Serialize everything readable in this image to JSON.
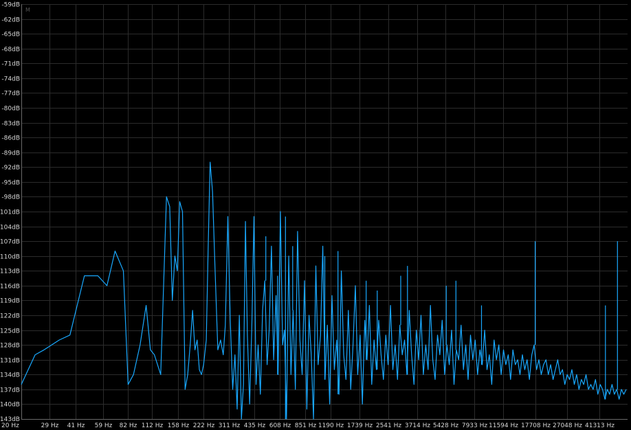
{
  "marker_label": "M",
  "chart_data": {
    "type": "line",
    "title": "",
    "xlabel": "",
    "ylabel": "",
    "xscale": "log",
    "xlim": [
      20,
      60000
    ],
    "ylim": [
      -143,
      -59
    ],
    "grid": true,
    "y_ticks": [
      "-59dB",
      "-62dB",
      "-65dB",
      "-68dB",
      "-71dB",
      "-74dB",
      "-77dB",
      "-80dB",
      "-83dB",
      "-86dB",
      "-89dB",
      "-92dB",
      "-95dB",
      "-98dB",
      "-101dB",
      "-104dB",
      "-107dB",
      "-110dB",
      "-113dB",
      "-116dB",
      "-119dB",
      "-122dB",
      "-125dB",
      "-128dB",
      "-131dB",
      "-134dB",
      "-137dB",
      "-140dB",
      "-143dB"
    ],
    "x_ticks": [
      {
        "label": "20 Hz",
        "hz": 20
      },
      {
        "label": "29 Hz",
        "hz": 29
      },
      {
        "label": "41 Hz",
        "hz": 41
      },
      {
        "label": "59 Hz",
        "hz": 59
      },
      {
        "label": "82 Hz",
        "hz": 82
      },
      {
        "label": "112 Hz",
        "hz": 112
      },
      {
        "label": "158 Hz",
        "hz": 158
      },
      {
        "label": "222 Hz",
        "hz": 222
      },
      {
        "label": "311 Hz",
        "hz": 311
      },
      {
        "label": "435 Hz",
        "hz": 435
      },
      {
        "label": "608 Hz",
        "hz": 608
      },
      {
        "label": "851 Hz",
        "hz": 851
      },
      {
        "label": "1190 Hz",
        "hz": 1190
      },
      {
        "label": "1739 Hz",
        "hz": 1739
      },
      {
        "label": "2541 Hz",
        "hz": 2541
      },
      {
        "label": "3714 Hz",
        "hz": 3714
      },
      {
        "label": "5428 Hz",
        "hz": 5428
      },
      {
        "label": "7933 Hz",
        "hz": 7933
      },
      {
        "label": "11594 Hz",
        "hz": 11594
      },
      {
        "label": "17708 Hz",
        "hz": 17708
      },
      {
        "label": "27048 Hz",
        "hz": 27048
      },
      {
        "label": "41313 Hz",
        "hz": 41313
      }
    ],
    "series": [
      {
        "values": [
          [
            20,
            -136
          ],
          [
            24,
            -130
          ],
          [
            27,
            -129
          ],
          [
            33,
            -127
          ],
          [
            38,
            -126
          ],
          [
            46,
            -114
          ],
          [
            55,
            -114
          ],
          [
            62,
            -116
          ],
          [
            69,
            -109
          ],
          [
            77,
            -113
          ],
          [
            82,
            -136
          ],
          [
            88,
            -134
          ],
          [
            96,
            -128
          ],
          [
            104,
            -120
          ],
          [
            110,
            -129
          ],
          [
            116,
            -130
          ],
          [
            126,
            -134
          ],
          [
            136,
            -98
          ],
          [
            142,
            -100
          ],
          [
            147,
            -119
          ],
          [
            152,
            -110
          ],
          [
            157,
            -113
          ],
          [
            162,
            -99
          ],
          [
            168,
            -101
          ],
          [
            174,
            -137
          ],
          [
            180,
            -134
          ],
          [
            186,
            -128
          ],
          [
            192,
            -121
          ],
          [
            198,
            -129
          ],
          [
            204,
            -127
          ],
          [
            210,
            -133
          ],
          [
            216,
            -134
          ],
          [
            222,
            -132
          ],
          [
            230,
            -127
          ],
          [
            236,
            -108
          ],
          [
            242,
            -91
          ],
          [
            250,
            -97
          ],
          [
            258,
            -112
          ],
          [
            268,
            -129
          ],
          [
            278,
            -127
          ],
          [
            288,
            -130
          ],
          [
            296,
            -124
          ],
          [
            306,
            -102
          ],
          [
            316,
            -123
          ],
          [
            326,
            -137
          ],
          [
            336,
            -130
          ],
          [
            346,
            -141
          ],
          [
            356,
            -122
          ],
          [
            366,
            -143
          ],
          [
            376,
            -136
          ],
          [
            386,
            -103
          ],
          [
            396,
            -126
          ],
          [
            408,
            -140
          ],
          [
            420,
            -124
          ],
          [
            432,
            -102
          ],
          [
            444,
            -136
          ],
          [
            456,
            -128
          ],
          [
            470,
            -138
          ],
          [
            484,
            -121
          ],
          [
            498,
            -115
          ],
          [
            514,
            -132
          ],
          [
            528,
            -125
          ],
          [
            544,
            -108
          ],
          [
            560,
            -131
          ],
          [
            578,
            -118
          ],
          [
            594,
            -134
          ],
          [
            612,
            -101
          ],
          [
            630,
            -128
          ],
          [
            646,
            -125
          ],
          [
            664,
            -143
          ],
          [
            684,
            -110
          ],
          [
            704,
            -134
          ],
          [
            724,
            -121
          ],
          [
            746,
            -137
          ],
          [
            768,
            -105
          ],
          [
            792,
            -127
          ],
          [
            816,
            -134
          ],
          [
            842,
            -115
          ],
          [
            868,
            -141
          ],
          [
            894,
            -122
          ],
          [
            920,
            -130
          ],
          [
            948,
            -143
          ],
          [
            978,
            -112
          ],
          [
            1008,
            -132
          ],
          [
            1040,
            -126
          ],
          [
            1072,
            -108
          ],
          [
            1104,
            -135
          ],
          [
            1138,
            -124
          ],
          [
            1174,
            -140
          ],
          [
            1210,
            -118
          ],
          [
            1248,
            -133
          ],
          [
            1288,
            -127
          ],
          [
            1328,
            -138
          ],
          [
            1370,
            -113
          ],
          [
            1412,
            -130
          ],
          [
            1456,
            -135
          ],
          [
            1502,
            -121
          ],
          [
            1550,
            -137
          ],
          [
            1598,
            -128
          ],
          [
            1648,
            -116
          ],
          [
            1700,
            -134
          ],
          [
            1754,
            -126
          ],
          [
            1808,
            -140
          ],
          [
            1866,
            -123
          ],
          [
            1924,
            -131
          ],
          [
            1984,
            -120
          ],
          [
            2046,
            -136
          ],
          [
            2110,
            -127
          ],
          [
            2176,
            -133
          ],
          [
            2244,
            -123
          ],
          [
            2314,
            -130
          ],
          [
            2388,
            -135
          ],
          [
            2464,
            -126
          ],
          [
            2540,
            -132
          ],
          [
            2620,
            -120
          ],
          [
            2702,
            -133
          ],
          [
            2788,
            -128
          ],
          [
            2876,
            -135
          ],
          [
            2966,
            -124
          ],
          [
            3060,
            -130
          ],
          [
            3156,
            -127
          ],
          [
            3256,
            -134
          ],
          [
            3358,
            -121
          ],
          [
            3464,
            -130
          ],
          [
            3574,
            -136
          ],
          [
            3686,
            -125
          ],
          [
            3802,
            -131
          ],
          [
            3922,
            -122
          ],
          [
            4046,
            -134
          ],
          [
            4174,
            -128
          ],
          [
            4306,
            -133
          ],
          [
            4442,
            -120
          ],
          [
            4582,
            -131
          ],
          [
            4726,
            -135
          ],
          [
            4876,
            -126
          ],
          [
            5030,
            -130
          ],
          [
            5188,
            -123
          ],
          [
            5352,
            -134
          ],
          [
            5522,
            -128
          ],
          [
            5696,
            -132
          ],
          [
            5876,
            -125
          ],
          [
            6062,
            -136
          ],
          [
            6254,
            -129
          ],
          [
            6452,
            -131
          ],
          [
            6656,
            -124
          ],
          [
            6866,
            -133
          ],
          [
            7082,
            -128
          ],
          [
            7306,
            -135
          ],
          [
            7538,
            -126
          ],
          [
            7776,
            -131
          ],
          [
            8022,
            -127
          ],
          [
            8276,
            -134
          ],
          [
            8538,
            -129
          ],
          [
            8808,
            -132
          ],
          [
            9086,
            -125
          ],
          [
            9374,
            -133
          ],
          [
            9670,
            -130
          ],
          [
            9976,
            -136
          ],
          [
            10292,
            -127
          ],
          [
            10618,
            -131
          ],
          [
            10954,
            -128
          ],
          [
            11300,
            -134
          ],
          [
            11658,
            -129
          ],
          [
            12026,
            -132
          ],
          [
            12406,
            -130
          ],
          [
            12800,
            -135
          ],
          [
            13204,
            -129
          ],
          [
            13622,
            -132
          ],
          [
            14052,
            -131
          ],
          [
            14496,
            -134
          ],
          [
            14956,
            -130
          ],
          [
            15428,
            -133
          ],
          [
            15916,
            -131
          ],
          [
            16420,
            -135
          ],
          [
            16940,
            -130
          ],
          [
            17476,
            -128
          ],
          [
            18030,
            -133
          ],
          [
            18600,
            -131
          ],
          [
            19188,
            -134
          ],
          [
            19796,
            -132
          ],
          [
            20420,
            -131
          ],
          [
            21068,
            -134
          ],
          [
            21734,
            -132
          ],
          [
            22422,
            -135
          ],
          [
            23132,
            -133
          ],
          [
            23864,
            -131
          ],
          [
            24618,
            -134
          ],
          [
            25398,
            -133
          ],
          [
            26202,
            -136
          ],
          [
            27030,
            -134
          ],
          [
            27886,
            -135
          ],
          [
            28768,
            -133
          ],
          [
            29680,
            -136
          ],
          [
            30618,
            -134
          ],
          [
            31588,
            -137
          ],
          [
            32588,
            -135
          ],
          [
            33618,
            -136
          ],
          [
            34682,
            -134
          ],
          [
            35780,
            -137
          ],
          [
            36912,
            -136
          ],
          [
            38080,
            -137
          ],
          [
            39286,
            -135
          ],
          [
            40528,
            -138
          ],
          [
            41812,
            -136
          ],
          [
            43134,
            -137
          ],
          [
            44500,
            -139
          ],
          [
            45908,
            -137
          ],
          [
            47362,
            -138
          ],
          [
            48860,
            -136
          ],
          [
            50406,
            -138
          ],
          [
            52002,
            -137
          ],
          [
            53648,
            -139
          ],
          [
            55346,
            -137
          ],
          [
            57098,
            -138
          ],
          [
            58906,
            -137
          ]
        ],
        "spikes": [
          [
            17708,
            -107
          ],
          [
            52500,
            -107
          ],
          [
            44800,
            -120
          ],
          [
            6220,
            -115
          ],
          [
            8720,
            -120
          ],
          [
            5470,
            -116
          ],
          [
            3000,
            -114
          ],
          [
            3280,
            -112
          ],
          [
            1900,
            -115
          ],
          [
            2200,
            -117
          ],
          [
            1100,
            -110
          ],
          [
            1310,
            -109
          ],
          [
            720,
            -108
          ],
          [
            655,
            -102
          ],
          [
            590,
            -114
          ],
          [
            505,
            -106
          ]
        ]
      }
    ]
  }
}
